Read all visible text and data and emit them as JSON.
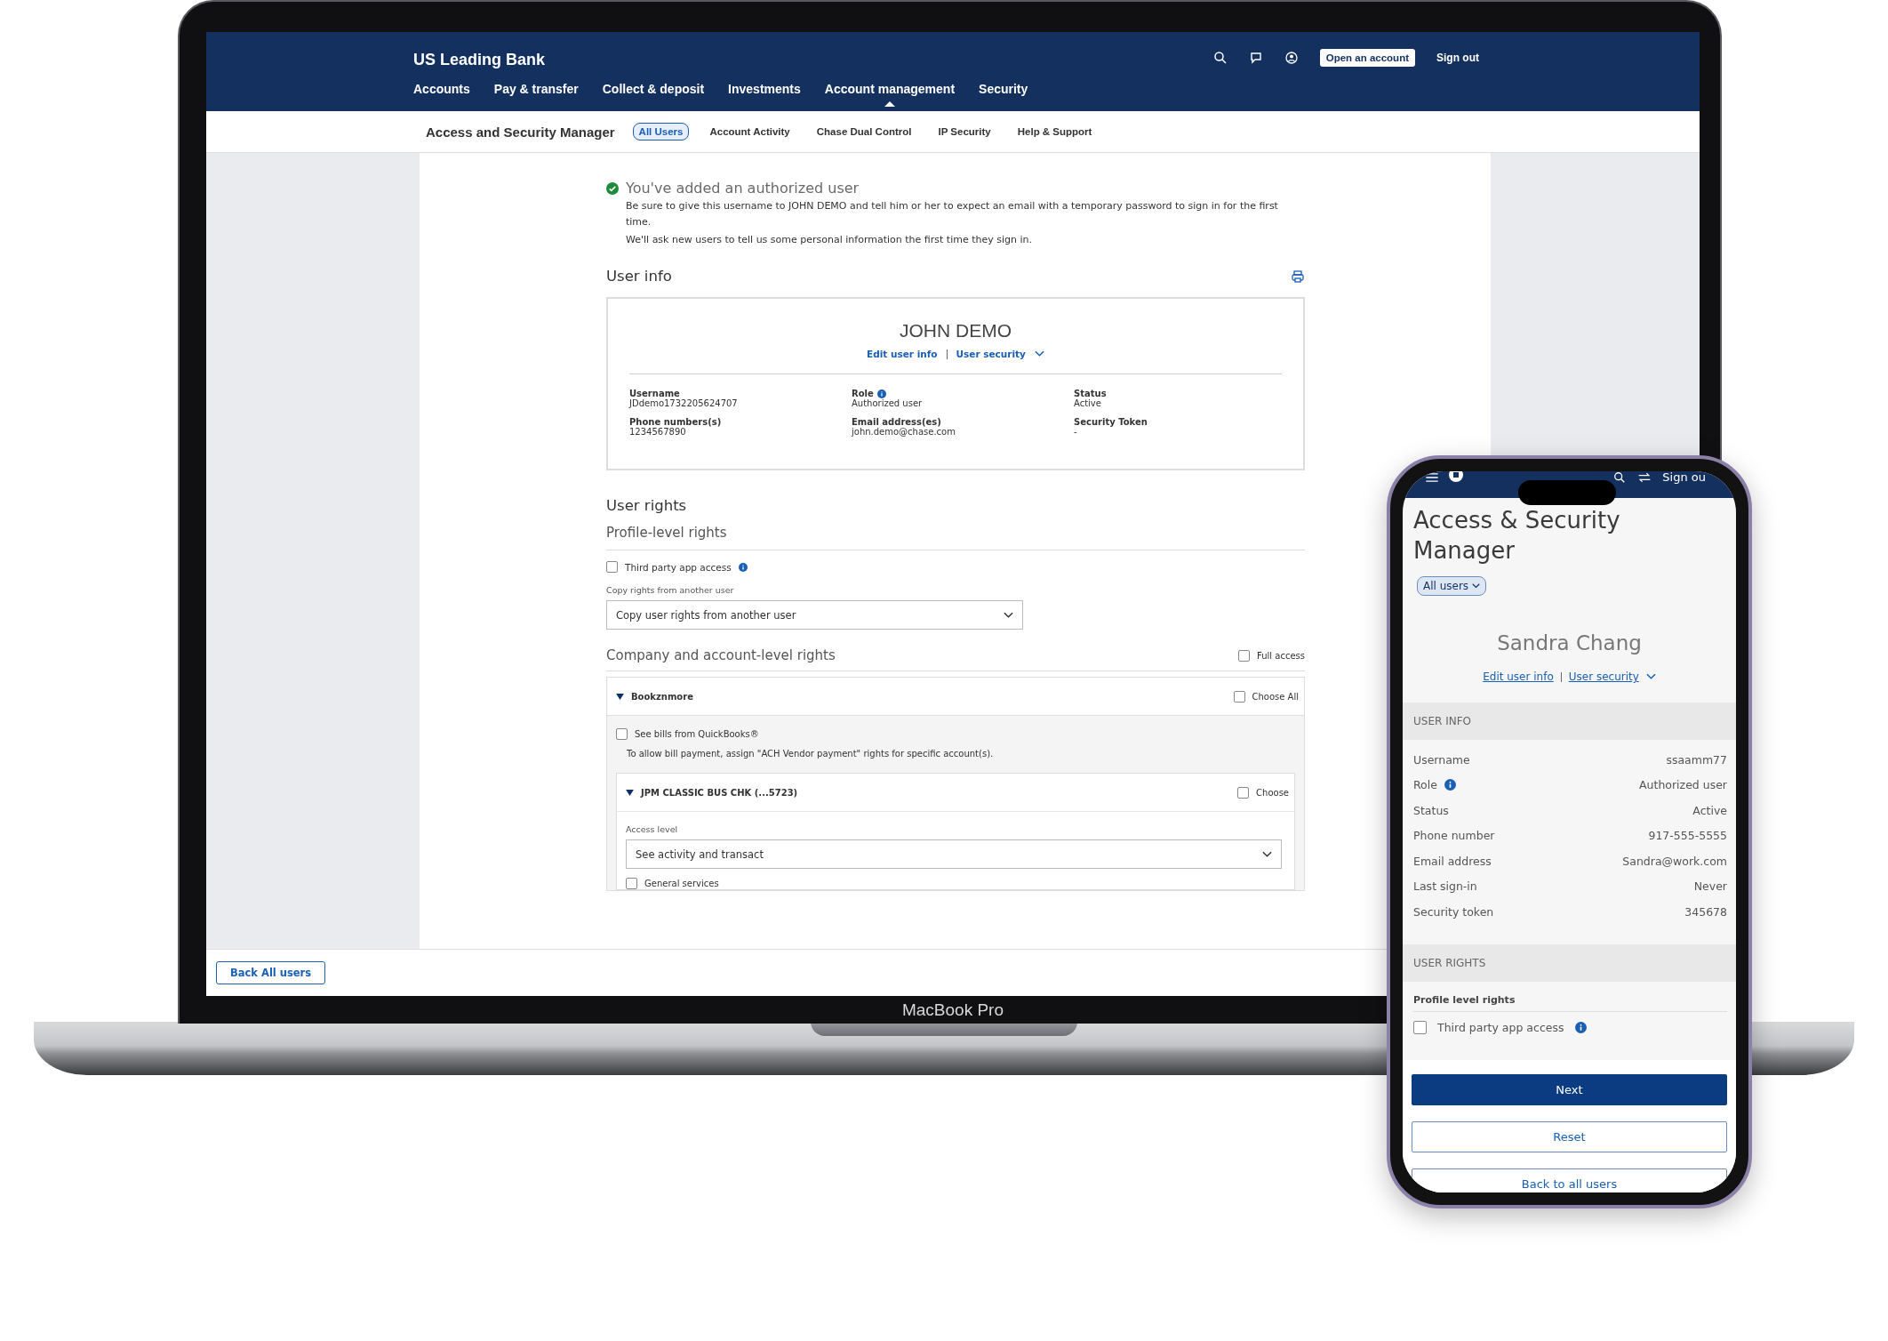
{
  "laptop": {
    "brand": "US Leading Bank",
    "header_actions": {
      "open_account": "Open an account",
      "sign_out": "Sign out"
    },
    "nav": [
      {
        "label": "Accounts",
        "selected": false
      },
      {
        "label": "Pay & transfer",
        "selected": false
      },
      {
        "label": "Collect & deposit",
        "selected": false
      },
      {
        "label": "Investments",
        "selected": false
      },
      {
        "label": "Account management",
        "selected": true
      },
      {
        "label": "Security",
        "selected": false
      }
    ],
    "subnav": {
      "title": "Access and Security Manager",
      "tabs": [
        {
          "label": "All Users",
          "selected": true
        },
        {
          "label": "Account Activity",
          "selected": false
        },
        {
          "label": "Chase Dual Control",
          "selected": false
        },
        {
          "label": "IP Security",
          "selected": false
        },
        {
          "label": "Help & Support",
          "selected": false
        }
      ]
    },
    "success": {
      "title": "You've added an authorized user",
      "lines": [
        "Be sure to give this username to JOHN DEMO and tell him or her to expect an email with a temporary password to sign in for the first time.",
        "We'll ask new users to tell us some personal information the first time they sign in."
      ]
    },
    "user_info": {
      "heading": "User info",
      "name": "JOHN DEMO",
      "edit_link": "Edit user info",
      "security_link": "User security",
      "fields": [
        {
          "label": "Username",
          "value": "JDdemo1732205624707",
          "info": false
        },
        {
          "label": "Role",
          "value": "Authorized user",
          "info": true
        },
        {
          "label": "Status",
          "value": "Active",
          "info": false
        },
        {
          "label": "Phone numbers(s)",
          "value": "1234567890",
          "info": false
        },
        {
          "label": "Email address(es)",
          "value": "john.demo@chase.com",
          "info": false
        },
        {
          "label": "Security Token",
          "value": "-",
          "info": false
        }
      ]
    },
    "user_rights": {
      "heading": "User rights",
      "profile_heading": "Profile-level rights",
      "third_party": {
        "label": "Third party app access",
        "checked": false,
        "info": true
      },
      "copy_label": "Copy rights from another user",
      "copy_select": "Copy user rights from another user",
      "company_heading": "Company and account-level rights",
      "full_access": {
        "label": "Full access",
        "checked": false
      },
      "company": {
        "name": "Bookznmore",
        "expanded": true,
        "choose": {
          "label": "Choose All",
          "checked": false
        },
        "quickbooks": {
          "label": "See bills from QuickBooks®",
          "checked": false
        },
        "note": "To allow bill payment, assign \"ACH Vendor payment\" rights for specific account(s).",
        "account": {
          "name": "JPM CLASSIC BUS CHK (...5723)",
          "expanded": true,
          "choose": {
            "label": "Choose",
            "checked": false
          },
          "access_label": "Access level",
          "access_select": "See activity and transact",
          "general": {
            "label": "General services",
            "checked": false
          }
        }
      }
    },
    "back_button": "Back All users",
    "model_label": "MacBook Pro"
  },
  "phone": {
    "header_sign_out": "Sign ou",
    "title": "Access & Security Manager",
    "users_dropdown": "All users",
    "name": "Sandra Chang",
    "edit_link": "Edit user info",
    "security_link": "User security",
    "user_info_heading": "USER INFO",
    "fields": [
      {
        "label": "Username",
        "value": "ssaamm77",
        "info": false
      },
      {
        "label": "Role",
        "value": "Authorized user",
        "info": true
      },
      {
        "label": "Status",
        "value": "Active",
        "info": false
      },
      {
        "label": "Phone number",
        "value": "917-555-5555",
        "info": false
      },
      {
        "label": "Email address",
        "value": "Sandra@work.com",
        "info": false
      },
      {
        "label": "Last sign-in",
        "value": "Never",
        "info": false
      },
      {
        "label": "Security token",
        "value": "345678",
        "info": false
      }
    ],
    "user_rights_heading": "USER RIGHTS",
    "profile_heading": "Profile level rights",
    "third_party": {
      "label": "Third party app access",
      "checked": false,
      "info": true
    },
    "buttons": [
      {
        "label": "Next",
        "kind": "primary"
      },
      {
        "label": "Reset",
        "kind": "secondary"
      },
      {
        "label": "Back to all users",
        "kind": "secondary"
      }
    ]
  }
}
